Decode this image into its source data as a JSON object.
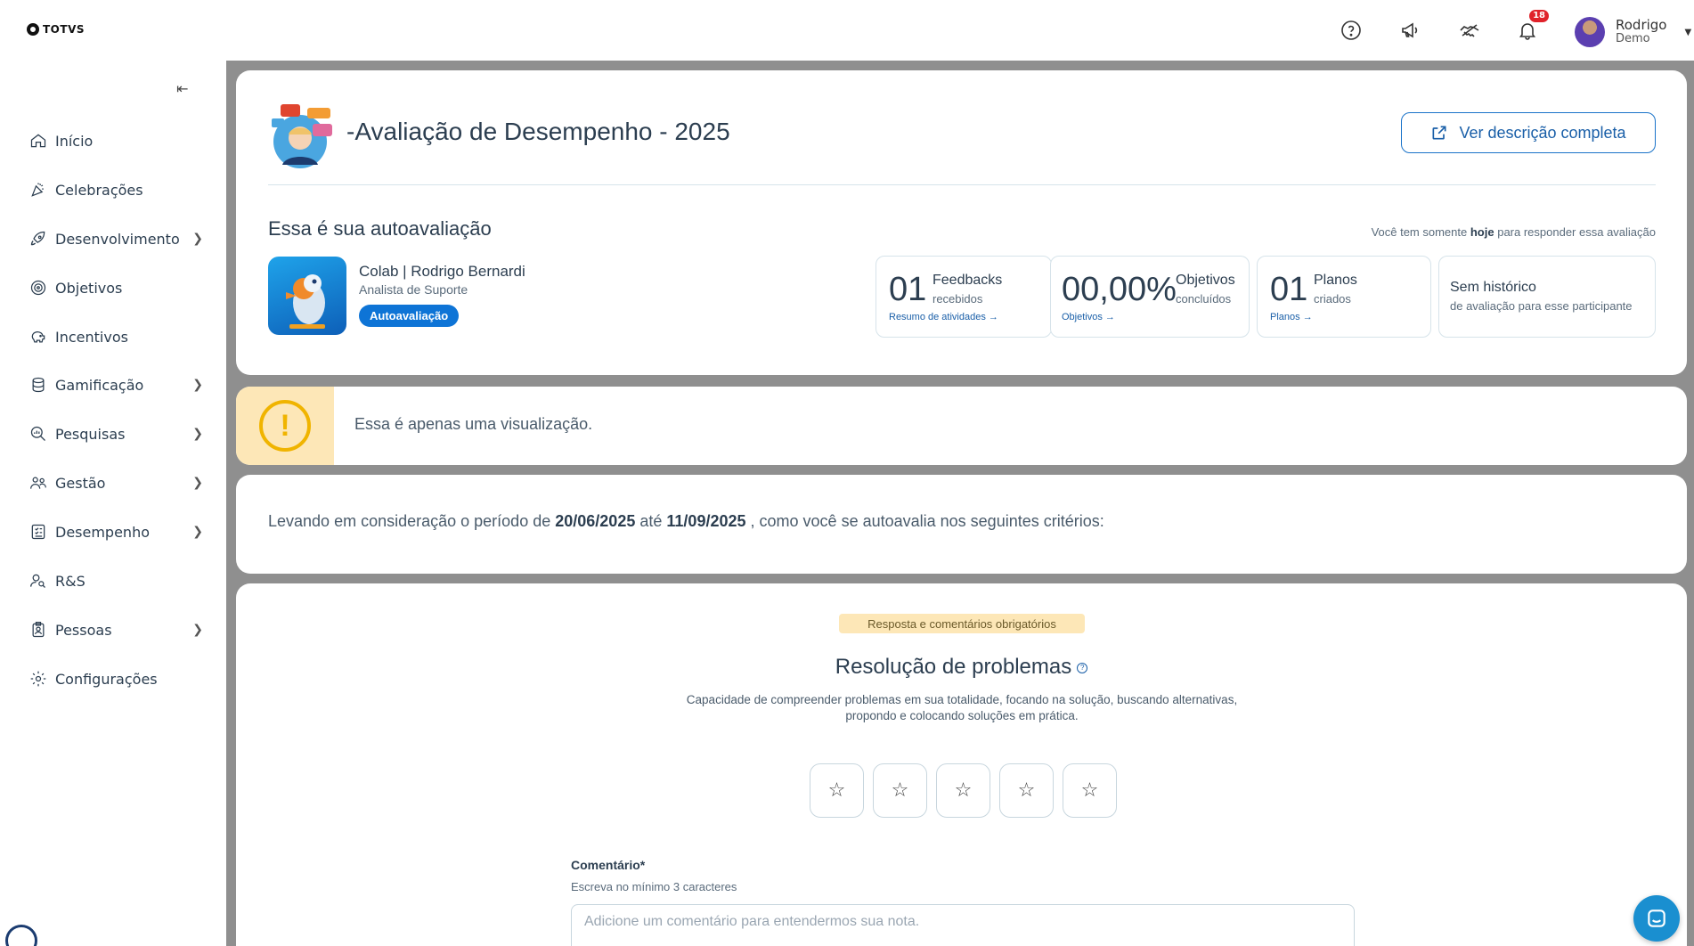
{
  "brand": {
    "logo_text": "TOTVS"
  },
  "header": {
    "notifications_count": "18",
    "user": {
      "name": "Rodrigo",
      "role": "Demo"
    }
  },
  "sidebar": {
    "items": [
      {
        "label": "Início",
        "icon": "home-icon",
        "has_submenu": false
      },
      {
        "label": "Celebrações",
        "icon": "party-popper-icon",
        "has_submenu": false
      },
      {
        "label": "Desenvolvimento",
        "icon": "rocket-icon",
        "has_submenu": true
      },
      {
        "label": "Objetivos",
        "icon": "target-icon",
        "has_submenu": false
      },
      {
        "label": "Incentivos",
        "icon": "piggy-bank-icon",
        "has_submenu": false
      },
      {
        "label": "Gamificação",
        "icon": "coins-icon",
        "has_submenu": true
      },
      {
        "label": "Pesquisas",
        "icon": "search-chart-icon",
        "has_submenu": true
      },
      {
        "label": "Gestão",
        "icon": "users-icon",
        "has_submenu": true
      },
      {
        "label": "Desempenho",
        "icon": "checklist-icon",
        "has_submenu": true
      },
      {
        "label": "R&S",
        "icon": "user-search-icon",
        "has_submenu": false
      },
      {
        "label": "Pessoas",
        "icon": "badge-icon",
        "has_submenu": true
      },
      {
        "label": "Configurações",
        "icon": "gear-icon",
        "has_submenu": false
      }
    ]
  },
  "evaluation": {
    "title": "-Avaliação de Desempenho - 2025",
    "view_full_label": "Ver descrição completa",
    "self_eval_title": "Essa é sua autoavaliação",
    "deadline": {
      "prefix": "Você tem somente",
      "highlight": "hoje",
      "suffix": "para responder essa avaliação"
    },
    "participant": {
      "name": "Colab | Rodrigo Bernardi",
      "role": "Analista de Suporte",
      "tag": "Autoavaliação"
    },
    "stats": [
      {
        "number": "01",
        "label": "Feedbacks",
        "sub": "recebidos",
        "link": "Resumo de atividades →"
      },
      {
        "number": "00,00%",
        "label": "Objetivos",
        "sub": "concluídos",
        "link": "Objetivos →"
      },
      {
        "number": "01",
        "label": "Planos",
        "sub": "criados",
        "link": "Planos →"
      }
    ],
    "history": {
      "title": "Sem histórico",
      "sub": "de avaliação para esse participante"
    }
  },
  "warning": {
    "text": "Essa é apenas uma visualização.",
    "icon": "exclamation-icon",
    "color": "#f0b400"
  },
  "period": {
    "prefix": "Levando em consideração o período de",
    "start": "20/06/2025",
    "middle": "até",
    "end": "11/09/2025",
    "suffix": ", como você se autoavalia nos seguintes critérios:"
  },
  "criterion": {
    "required_tag": "Resposta e comentários obrigatórios",
    "title": "Resolução de problemas",
    "description": "Capacidade de compreender problemas em sua totalidade, focando na solução, buscando alternativas, propondo e colocando soluções em prática.",
    "rating_max": 5,
    "comment_label": "Comentário*",
    "comment_hint": "Escreva no mínimo 3 caracteres",
    "comment_placeholder": "Adicione um comentário para entendermos sua nota."
  },
  "colors": {
    "accent": "#0e74d6",
    "warning_bg": "#fde7b7",
    "badge": "#e0222a",
    "main_bg": "#8f8f8f"
  }
}
